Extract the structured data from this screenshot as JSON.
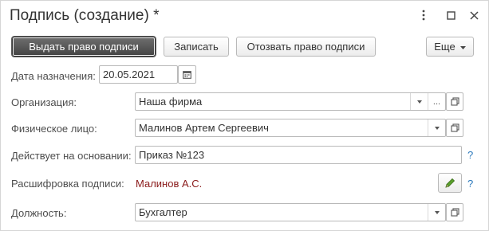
{
  "window": {
    "title": "Подпись (создание) *"
  },
  "toolbar": {
    "issue_label": "Выдать право подписи",
    "save_label": "Записать",
    "revoke_label": "Отозвать право подписи",
    "more_label": "Еще"
  },
  "form": {
    "date": {
      "label": "Дата назначения:",
      "value": "20.05.2021"
    },
    "organization": {
      "label": "Организация:",
      "value": "Наша фирма"
    },
    "person": {
      "label": "Физическое лицо:",
      "value": "Малинов Артем Сергеевич"
    },
    "basis": {
      "label": "Действует на основании:",
      "value": "Приказ №123",
      "help": "?"
    },
    "decode": {
      "label": "Расшифровка подписи:",
      "value": "Малинов А.С.",
      "help": "?"
    },
    "position": {
      "label": "Должность:",
      "value": "Бухгалтер"
    }
  },
  "icons": {
    "more_menu": "more-vertical-icon",
    "maximize": "maximize-icon",
    "close": "close-icon",
    "calendar": "calendar-icon",
    "open": "open-icon",
    "edit": "pencil-icon"
  },
  "colors": {
    "primary_button": "#4a4a4a",
    "help": "#2e7bbd",
    "decode_text": "#8a1a1a",
    "pencil": "#5aa02c"
  }
}
